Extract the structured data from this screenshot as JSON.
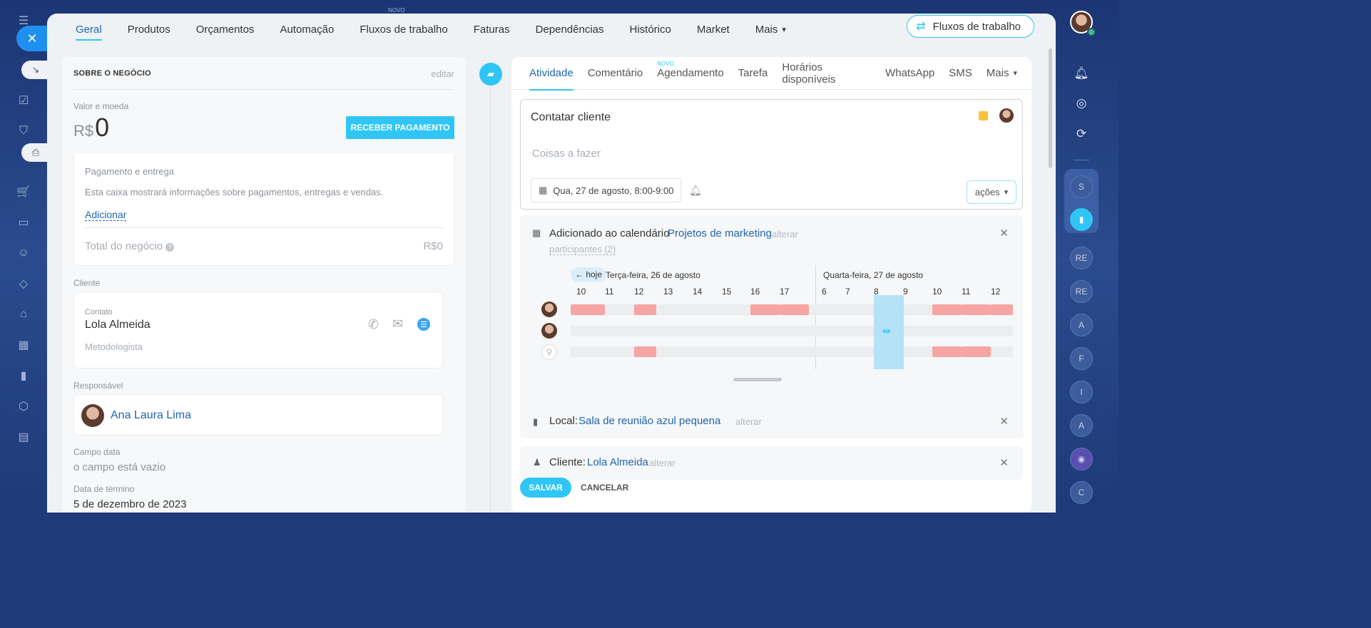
{
  "top_badge": "NOVO",
  "nav": {
    "tabs": [
      "Geral",
      "Produtos",
      "Orçamentos",
      "Automação",
      "Fluxos de trabalho",
      "Faturas",
      "Dependências",
      "Histórico",
      "Market",
      "Mais"
    ],
    "workflows_button": "Fluxos de trabalho"
  },
  "about": {
    "title": "SOBRE O NEGÓCIO",
    "edit": "editar",
    "value_label": "Valor e moeda",
    "currency": "R$",
    "amount": "0",
    "pay_button": "RECEBER PAGAMENTO",
    "payment_title": "Pagamento e entrega",
    "payment_desc": "Esta caixa mostrará informações sobre pagamentos, entregas e vendas.",
    "add_link": "Adicionar",
    "total_label": "Total do negócio",
    "total_value": "R$0",
    "client_label": "Cliente",
    "contact_label": "Contato",
    "contact_name": "Lola Almeida",
    "contact_role": "Metodologista",
    "responsible_label": "Responsável",
    "responsible_name": "Ana Laura Lima",
    "date_field_label": "Campo data",
    "date_field_value": "o campo está vazio",
    "end_date_label": "Data de término",
    "end_date_value": "5 de dezembro de 2023"
  },
  "activity": {
    "tabs": [
      "Atividade",
      "Comentário",
      "Agendamento",
      "Tarefa",
      "Horários disponíveis",
      "WhatsApp",
      "SMS",
      "Mais"
    ],
    "new_badge": "NOVO",
    "todo_title": "Contatar cliente",
    "todo_placeholder": "Coisas a fazer",
    "date_chip": "Qua, 27 de agosto, 8:00-9:00",
    "actions_button": "ações",
    "calendar_added": "Adicionado ao calendário",
    "calendar_name": "Projetos de marketing",
    "change": "alterar",
    "participants": "participantes (2)",
    "today_button": "← hoje",
    "day1": "Terça-feira, 26 de agosto",
    "day2": "Quarta-feira, 27 de agosto",
    "hours_day1": [
      "10",
      "11",
      "12",
      "13",
      "14",
      "15",
      "16",
      "17"
    ],
    "hours_day2": [
      "6",
      "7",
      "8",
      "9",
      "10",
      "11",
      "12"
    ],
    "location_label": "Local:",
    "location_value": "Sala de reunião azul pequena",
    "client_label": "Cliente:",
    "client_value": "Lola Almeida",
    "save": "SALVAR",
    "cancel": "CANCELAR"
  },
  "right_rail": {
    "avatars": [
      "S",
      "RE",
      "RE",
      "A",
      "F",
      "I",
      "A",
      "C"
    ]
  },
  "colors": {
    "accent": "#2fc6f6",
    "link": "#2066b0",
    "busy": "#f7a4a4"
  }
}
